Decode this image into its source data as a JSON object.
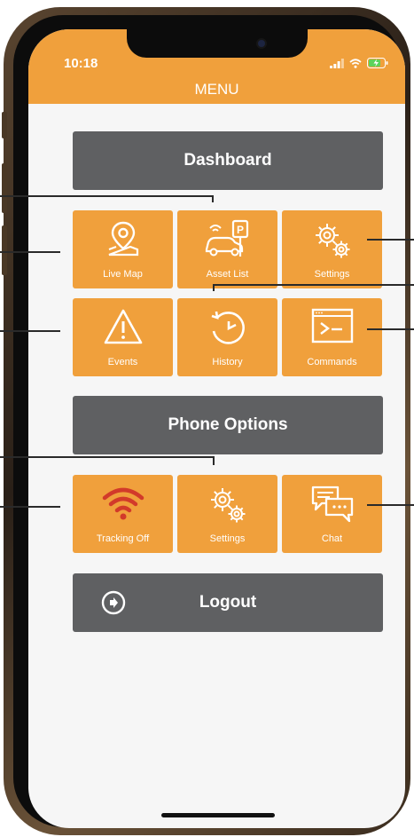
{
  "status_bar": {
    "time": "10:18"
  },
  "header": {
    "title": "MENU"
  },
  "sections": {
    "dashboard_label": "Dashboard",
    "phone_options_label": "Phone Options",
    "logout_label": "Logout"
  },
  "dashboard_tiles": [
    {
      "label": "Live Map",
      "icon": "map-pin-icon"
    },
    {
      "label": "Asset List",
      "icon": "vehicle-parking-icon"
    },
    {
      "label": "Settings",
      "icon": "gears-icon"
    },
    {
      "label": "Events",
      "icon": "warning-icon"
    },
    {
      "label": "History",
      "icon": "history-clock-icon"
    },
    {
      "label": "Commands",
      "icon": "terminal-icon"
    }
  ],
  "phone_tiles": [
    {
      "label": "Tracking Off",
      "icon": "wifi-signal-icon"
    },
    {
      "label": "Settings",
      "icon": "gears-icon"
    },
    {
      "label": "Chat",
      "icon": "chat-bubbles-icon"
    }
  ],
  "colors": {
    "accent": "#f0a03c",
    "gray_button": "#5f6062",
    "tracking_off": "#d23a2a",
    "background": "#f6f6f6"
  }
}
